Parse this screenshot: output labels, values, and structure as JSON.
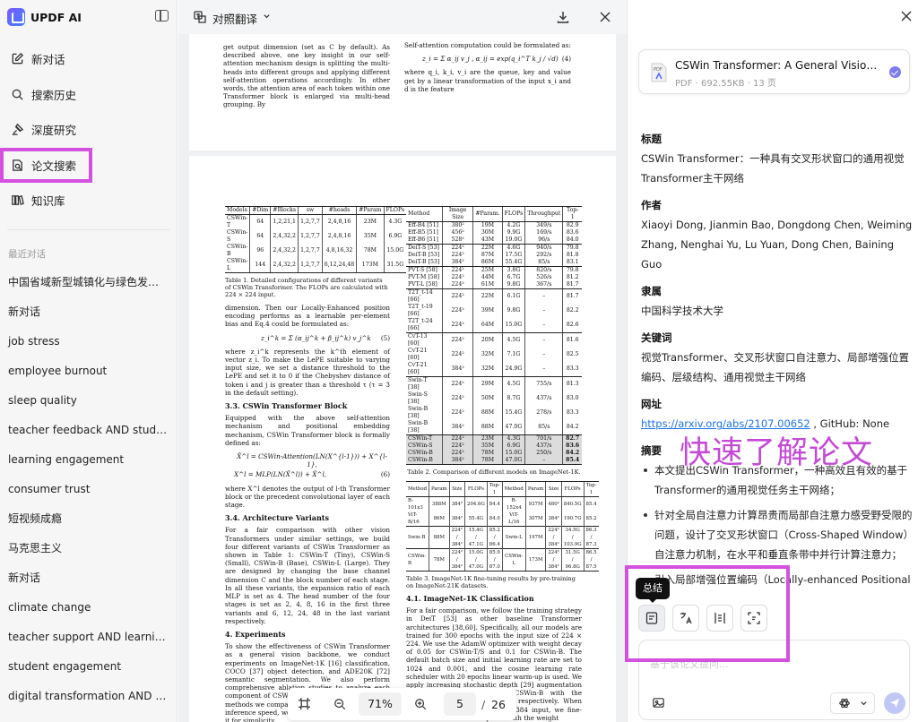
{
  "app": {
    "name": "UPDF AI"
  },
  "nav": [
    {
      "label": "新对话",
      "icon": "new-chat-icon"
    },
    {
      "label": "搜索历史",
      "icon": "search-icon"
    },
    {
      "label": "深度研究",
      "icon": "research-icon"
    },
    {
      "label": "论文搜索",
      "icon": "paper-search-icon",
      "selected": true
    },
    {
      "label": "知识库",
      "icon": "library-icon"
    }
  ],
  "recent": {
    "title": "最近对话",
    "items": [
      "中国省域新型城镇化与绿色发展...",
      "新对话",
      "job stress",
      "employee burnout",
      "sleep quality",
      "teacher feedback AND stude...",
      "learning engagement",
      "consumer trust",
      "短视频成瘾",
      "马克思主义",
      "新对话",
      "climate change",
      "teacher support AND learnin...",
      "student engagement",
      "digital transformation AND fi..."
    ]
  },
  "doc": {
    "translate_label": "对照翻译",
    "page1": {
      "left": "get output dimension (set as C by default). As described above, one key insight in our self-attention mechanism design is splitting the multi-heads into different groups and applying different self-attention operations accordingly. In other words, the attention area of each token within one Transformer block is enlarged via multi-head grouping. By",
      "right_top": "Self-attention computation could be formulated as:",
      "eq": "z_i = Σ α_ij v_j , α_ij = exp(q_i^T k_j / √d)",
      "eq_no": "(4)",
      "right_bottom": "where q_i, k_i, v_i are the queue, key and value get by a linear transformation of the input x_i and d is the feature"
    },
    "page2": {
      "t1_head": [
        "Models",
        "#Dim",
        "#Blocks",
        "sw",
        "#heads",
        "#Param",
        "FLOPs"
      ],
      "t1_rows": [
        [
          "CSWin-T",
          "64",
          "1,2,21,1",
          "1,2,7,7",
          "2,4,8,16",
          "23M",
          "4.3G"
        ],
        [
          "CSWin-S",
          "64",
          "2,4,32,2",
          "1,2,7,7",
          "2,4,8,16",
          "35M",
          "6.9G"
        ],
        [
          "CSWin-B",
          "96",
          "2,4,32,2",
          "1,2,7,7",
          "4,8,16,32",
          "78M",
          "15.0G"
        ],
        [
          "CSWin-L",
          "144",
          "2,4,32,2",
          "1,2,7,7",
          "6,12,24,48",
          "173M",
          "31.5G"
        ]
      ],
      "t1_cap": "Table 1. Detailed configurations of different variants of CSWin Transformer. The FLOPs are calculated with 224 × 224 input.",
      "p_dim": "dimension. Then our Locally-Enhanced position encoding performs as a learnable per-element bias and Eq.4 could be formulated as:",
      "eq5": "z_i^k = Σ (α_ij^k + β_ij^k) v_j^k",
      "eq5_no": "(5)",
      "p_where": "where z_i^k represents the k^th element of vector z_i. To make the LePE suitable to varying input size, we set a distance threshold to the LePE and set it to 0 if the Chebyshev distance of token i and j is greater than a threshold τ (τ = 3 in the default setting).",
      "h33": "3.3. CSWin Transformer Block",
      "p33": "Equipped with the above self-attention mechanism and positional embedding mechanism, CSWin Transformer block is formally defined as:",
      "eq6a": "X̂^l = CSWin-Attention(LN(X^{l-1})) + X^{l-1},",
      "eq6b": "X^l = MLP(LN(X̂^l)) + X̂^l,",
      "eq6_no": "(6)",
      "p_where2": "where X^l denotes the output of l-th Transformer block or the precedent convolutional layer of each stage.",
      "h34": "3.4. Architecture Variants",
      "p34": "For a fair comparison with other vision Transformers under similar settings, we build four different variants of CSWin Transformer as shown in Table 1: CSWin-T (Tiny), CSWin-S (Small), CSWin-B (Base), CSWin-L (Large). They are designed by changing the base channel dimension C and the block number of each stage. In all these variants, the expansion ratio of each MLP is set as 4. The head number of the four stages is set as 2, 4, 8, 16 in the first three variants and 6, 12, 24, 48 in the last variant respectively.",
      "h4": "4. Experiments",
      "p4": "To show the effectiveness of CSWin Transformer as a general vision backbone, we conduct experiments on ImageNet-1K [16] classification, COCO [37] object detection, and ADE20K [72] semantic segmentation. We also perform comprehensive ablation studies to analyze each component of CSWin Transformer. As most of the methods we compared did not report downstream inference speed, we use an extra section to report it for simplicity.",
      "t2_head": [
        "Method",
        "Image Size",
        "#Param.",
        "FLOPs",
        "Throughput",
        "Top-1"
      ],
      "t2_groups": [
        [
          [
            "Eff-B4 [51]",
            "380²",
            "19M",
            "4.2G",
            "349/s",
            "82.9"
          ],
          [
            "Eff-B5 [51]",
            "456²",
            "30M",
            "9.9G",
            "169/s",
            "83.6"
          ],
          [
            "Eff-B6 [51]",
            "528²",
            "43M",
            "19.0G",
            "96/s",
            "84.0"
          ]
        ],
        [
          [
            "DeiT-S [53]",
            "224²",
            "22M",
            "4.6G",
            "940/s",
            "79.8"
          ],
          [
            "DeiT-B [53]",
            "224²",
            "87M",
            "17.5G",
            "292/s",
            "81.8"
          ],
          [
            "DeiT-B [53]",
            "384²",
            "86M",
            "55.4G",
            "85/s",
            "83.1"
          ]
        ],
        [
          [
            "PVT-S [58]",
            "224²",
            "25M",
            "3.8G",
            "820/s",
            "79.8"
          ],
          [
            "PVT-M [58]",
            "224²",
            "44M",
            "6.7G",
            "526/s",
            "81.2"
          ],
          [
            "PVT-L [58]",
            "224²",
            "61M",
            "9.8G",
            "367/s",
            "81.7"
          ]
        ],
        [
          [
            "T2T_t-14 [66]",
            "224²",
            "22M",
            "6.1G",
            "–",
            "81.7"
          ],
          [
            "T2T_t-19 [66]",
            "224²",
            "39M",
            "9.8G",
            "–",
            "82.2"
          ],
          [
            "T2T_t-24 [66]",
            "224²",
            "64M",
            "15.0G",
            "–",
            "82.6"
          ]
        ],
        [
          [
            "CvT-13 [60]",
            "224²",
            "20M",
            "4.5G",
            "–",
            "81.6"
          ],
          [
            "CvT-21 [60]",
            "224²",
            "32M",
            "7.1G",
            "–",
            "82.5"
          ],
          [
            "CvT-21 [60]",
            "384²",
            "32M",
            "24.9G",
            "–",
            "83.3"
          ]
        ],
        [
          [
            "Swin-T [38]",
            "224²",
            "29M",
            "4.5G",
            "755/s",
            "81.3"
          ],
          [
            "Swin-S [38]",
            "224²",
            "50M",
            "8.7G",
            "437/s",
            "83.0"
          ],
          [
            "Swin-B [38]",
            "224²",
            "88M",
            "15.4G",
            "278/s",
            "83.3"
          ],
          [
            "Swin-B [38]",
            "384²",
            "88M",
            "47.0G",
            "85/s",
            "84.2"
          ]
        ]
      ],
      "t2_cswin": [
        [
          "CSWin-T",
          "224²",
          "23M",
          "4.3G",
          "701/s",
          "82.7"
        ],
        [
          "CSWin-S",
          "224²",
          "35M",
          "6.9G",
          "437/s",
          "83.6"
        ],
        [
          "CSWin-B",
          "224²",
          "78M",
          "15.0G",
          "250/s",
          "84.2"
        ],
        [
          "CSWin-B",
          "384²",
          "78M",
          "47.0G",
          "–",
          "85.4"
        ]
      ],
      "t2_cap": "Table 2. Comparison of different models on ImageNet-1K.",
      "t3_head": [
        "Method",
        "Param",
        "Size",
        "FLOPs",
        "Top-1",
        "Method",
        "Param",
        "Size",
        "FLOPs",
        "Top-1"
      ],
      "t3_rows": [
        [
          "R-101x3",
          "388M",
          "384²",
          "204.6G",
          "84.4",
          "R-152x4",
          "937M",
          "480²",
          "840.5G",
          "85.4"
        ],
        [
          "ViT-B/16",
          "86M",
          "384²",
          "55.4G",
          "84.0",
          "ViT-L/16",
          "307M",
          "384²",
          "190.7G",
          "85.2"
        ],
        [
          "Swin-B",
          "88M",
          "224² / 384²",
          "15.4G / 47.1G",
          "85.2 / 86.4",
          "Swin-L",
          "197M",
          "224² / 384²",
          "34.5G / 103.9G",
          "86.3 / 87.3"
        ],
        [
          "CSWin-B",
          "78M",
          "224² / 384²",
          "15.0G / 47.0G",
          "85.9 / 87.0",
          "CSWin-L",
          "173M",
          "224² / 384²",
          "31.5G / 96.8G",
          "86.5 / 87.5"
        ]
      ],
      "t3_cap": "Table 3. ImageNet-1K fine-tuning results by pre-training on ImageNet-21K datasets.",
      "h41": "4.1. ImageNet-1K Classification",
      "p41": "For a fair comparison, we follow the training strategy in DeiT [53] as other baseline Transformer architectures [38,60]. Specifically, all our models are trained for 300 epochs with the input size of 224 × 224. We use the AdamW optimizer with weight decay of 0.05 for CSWin-T/S and 0.1 for CSWin-B. The default batch size and initial learning rate are set to 1024 and 0.001, and the cosine learning rate scheduler with 20 epochs linear warm-up is used. We apply increasing stochastic depth [29] augmentation for CSWin-T, CSWin-S, and CSWin-B with the maximum rate as 0.1, 0.3, 0.5 respectively. When reporting the results of 384 × 384 input, we fine-tune the models for 30 epochs with the weight"
    },
    "zoom": "71%",
    "page_current": "5",
    "page_sep": "/",
    "page_total": "26"
  },
  "panel": {
    "file": {
      "name": "CSWin Transformer: A General Vision Tr...",
      "meta": "PDF · 692.55KB · 13 页"
    },
    "title_h": "标题",
    "title": "CSWin Transformer：一种具有交叉形状窗口的通用视觉Transformer主干网络",
    "authors_h": "作者",
    "authors": "Xiaoyi Dong, Jianmin Bao, Dongdong Chen, Weiming Zhang, Nenghai Yu, Lu Yuan, Dong Chen, Baining Guo",
    "affil_h": "隶属",
    "affil": "中国科学技术大学",
    "kw_h": "关键词",
    "kw": "视觉Transformer、交叉形状窗口自注意力、局部增强位置编码、层级结构、通用视觉主干网络",
    "url_h": "网址",
    "url": "https://arxiv.org/abs/2107.00652",
    "url_suffix": " , GitHub: None",
    "abs_h": "摘要",
    "abs": [
      "本文提出CSWin Transformer，一种高效且有效的基于Transformer的通用视觉任务主干网络；",
      "针对全局自注意力计算昂贵而局部自注意力感受野受限的问题，设计了交叉形状窗口（Cross-Shaped Window）自注意力机制，在水平和垂直条带中并行计算注意力；",
      "引入局部增强位置编码（Locally-enhanced Positional"
    ],
    "overlay": "快速了解论文",
    "tooltip": "总结",
    "tools": [
      "summary-icon",
      "translate-icon",
      "explain-icon",
      "rewrite-icon"
    ],
    "input_placeholder": "基于该论文提问...",
    "accent": "#d451e0"
  }
}
